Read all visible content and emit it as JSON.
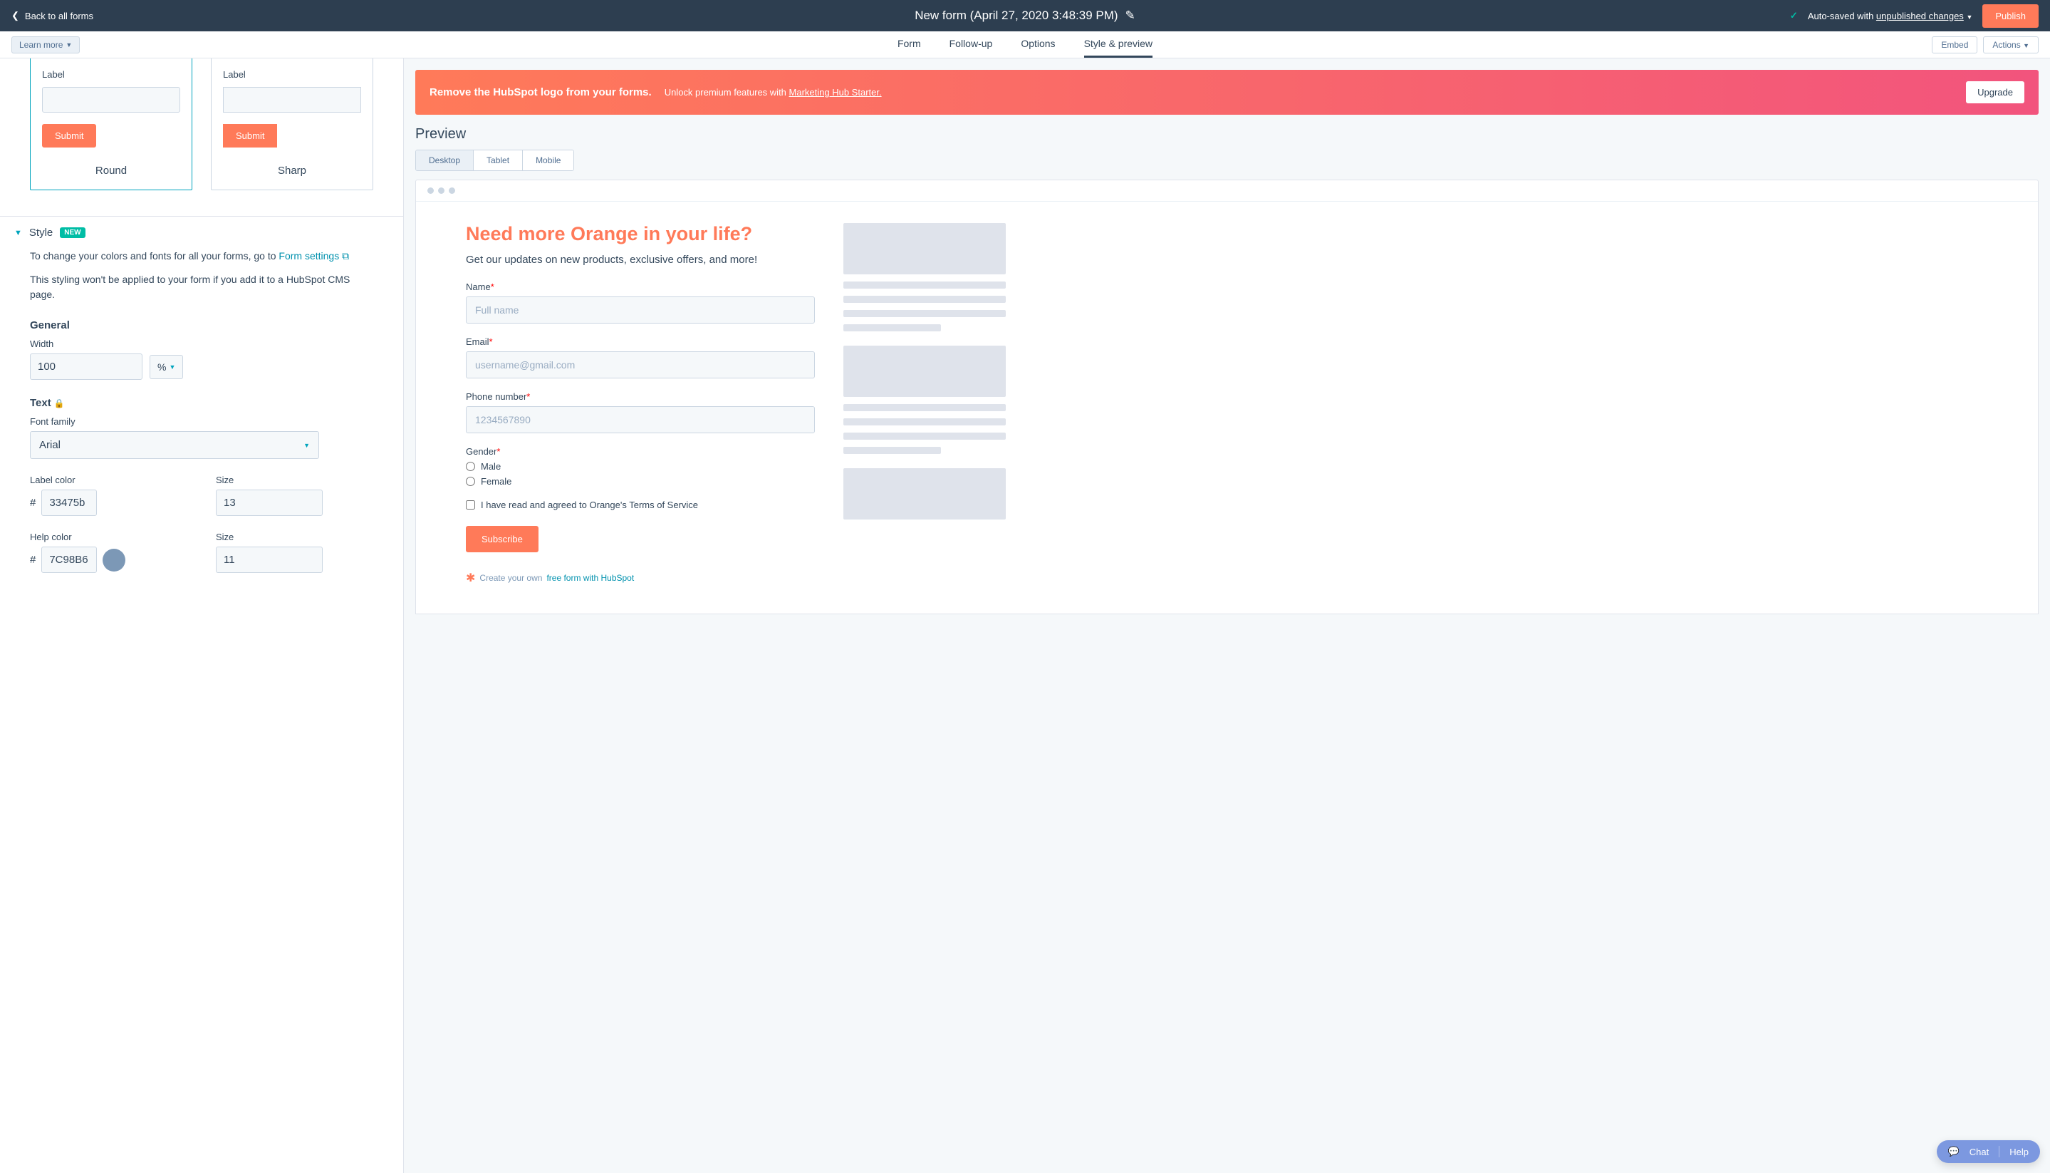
{
  "topbar": {
    "back_label": "Back to all forms",
    "title": "New form (April 27, 2020 3:48:39 PM)",
    "autosave_prefix": "Auto-saved with ",
    "autosave_link": "unpublished changes",
    "publish_label": "Publish"
  },
  "subbar": {
    "learn_more": "Learn more",
    "tabs": {
      "form": "Form",
      "followup": "Follow-up",
      "options": "Options",
      "style": "Style & preview"
    },
    "embed": "Embed",
    "actions": "Actions"
  },
  "shapes": {
    "label_text": "Label",
    "submit_text": "Submit",
    "round": "Round",
    "sharp": "Sharp"
  },
  "style_section": {
    "title": "Style",
    "badge": "NEW",
    "desc_prefix": "To change your colors and fonts for all your forms, go to ",
    "desc_link": "Form settings",
    "note": "This styling won't be applied to your form if you add it to a HubSpot CMS page.",
    "general": "General",
    "width_label": "Width",
    "width_value": "100",
    "width_unit": "%",
    "text": "Text",
    "font_family_label": "Font family",
    "font_family_value": "Arial",
    "label_color_label": "Label color",
    "label_color_value": "33475b",
    "label_color_hex": "#33475b",
    "size_label": "Size",
    "label_size_value": "13",
    "help_color_label": "Help color",
    "help_color_value": "7C98B6",
    "help_color_hex": "#7C98B6",
    "help_size_value": "11"
  },
  "preview": {
    "banner_title": "Remove the HubSpot logo from your forms.",
    "banner_sub": "Unlock premium features with ",
    "banner_link": "Marketing Hub Starter.",
    "upgrade": "Upgrade",
    "title": "Preview",
    "devices": {
      "desktop": "Desktop",
      "tablet": "Tablet",
      "mobile": "Mobile"
    },
    "form": {
      "heading": "Need more Orange in your life?",
      "sub": "Get our updates on new products, exclusive offers, and more!",
      "name_label": "Name",
      "name_placeholder": "Full name",
      "email_label": "Email",
      "email_placeholder": "username@gmail.com",
      "phone_label": "Phone number",
      "phone_placeholder": "1234567890",
      "gender_label": "Gender",
      "gender_male": "Male",
      "gender_female": "Female",
      "tos": "I have read and agreed to Orange's Terms of Service",
      "submit": "Subscribe",
      "credit_prefix": "Create your own ",
      "credit_link": "free form with HubSpot"
    }
  },
  "chat_help": {
    "chat": "Chat",
    "help": "Help"
  }
}
